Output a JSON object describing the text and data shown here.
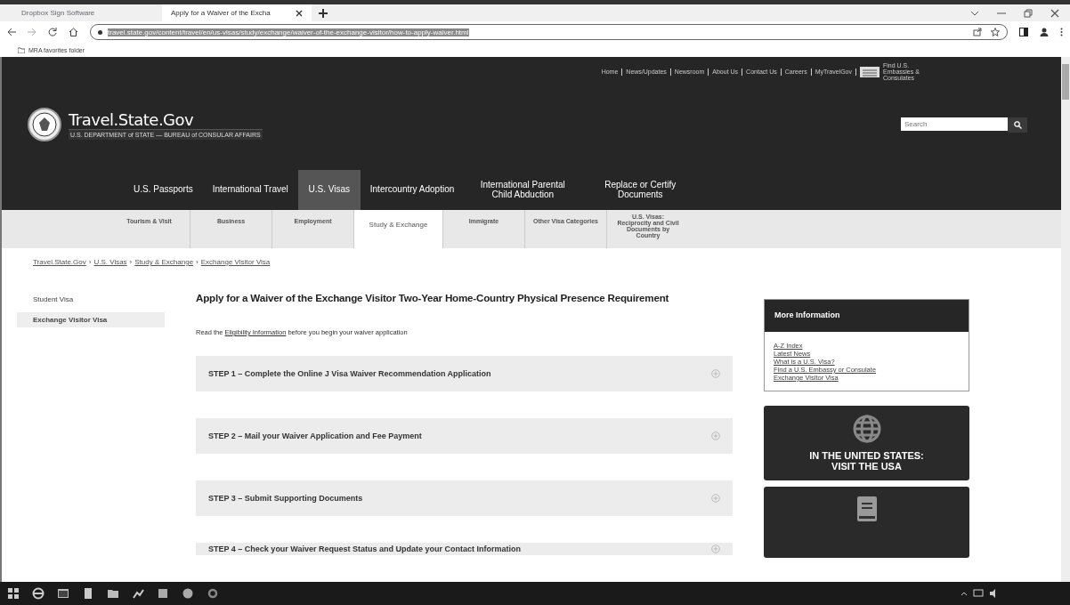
{
  "browser": {
    "tabs": [
      {
        "title": "Dropbox Sign Software",
        "selected": false
      },
      {
        "title": "Apply for a Waiver of the Excha",
        "selected": true
      }
    ],
    "url": "travel.state.gov/content/travel/en/us-visas/study/exchange/waiver-of-the-exchange-visitor/how-to-apply-waiver.html",
    "bookmarks": [
      "MRA favorites folder"
    ]
  },
  "utility_links": [
    "Home",
    "News/Updates",
    "Newsroom",
    "About Us",
    "Contact Us",
    "Careers",
    "MyTravelGov"
  ],
  "embassy_link": "Find U.S. Embassies & Consulates",
  "logo": {
    "title": "Travel.State.Gov",
    "subtitle": "U.S. DEPARTMENT of STATE — BUREAU of CONSULAR AFFAIRS"
  },
  "search": {
    "placeholder": "Search"
  },
  "main_nav": [
    {
      "label": "U.S. Passports",
      "selected": false
    },
    {
      "label": "International Travel",
      "selected": false
    },
    {
      "label": "U.S. Visas",
      "selected": true
    },
    {
      "label": "Intercountry Adoption",
      "selected": false
    },
    {
      "label": "International Parental Child Abduction",
      "selected": false
    },
    {
      "label": "Replace or Certify Documents",
      "selected": false
    }
  ],
  "sub_nav": [
    {
      "label": "Tourism & Visit",
      "selected": false
    },
    {
      "label": "Business",
      "selected": false
    },
    {
      "label": "Employment",
      "selected": false
    },
    {
      "label": "Study & Exchange",
      "selected": true
    },
    {
      "label": "Immigrate",
      "selected": false
    },
    {
      "label": "Other Visa Categories",
      "selected": false
    },
    {
      "label": "U.S. Visas: Reciprocity and Civil Documents by Country",
      "selected": false
    }
  ],
  "breadcrumb": [
    "Travel.State.Gov",
    "U.S. Visas",
    "Study & Exchange",
    "Exchange Visitor Visa"
  ],
  "breadcrumb_separator": "›",
  "sidebar": [
    {
      "label": "Student Visa",
      "selected": false
    },
    {
      "label": "Exchange Visitor Visa",
      "selected": true
    }
  ],
  "title": "Apply for a Waiver of the Exchange Visitor Two-Year Home-Country Physical Presence Requirement",
  "intro": {
    "before": "Read the",
    "link": "Eligibility Information",
    "after": "before you begin your waiver application"
  },
  "steps": [
    "STEP 1 – Complete the Online J Visa Waiver Recommendation Application",
    "STEP 2 – Mail your Waiver Application and Fee Payment",
    "STEP 3 – Submit Supporting Documents",
    "STEP 4 – Check your Waiver Request Status and Update your Contact Information"
  ],
  "more_info": {
    "title": "More Information",
    "links": [
      "A-Z Index",
      "Latest News",
      "What is a U.S. Visa?",
      "Find a U.S. Embassy or Consulate",
      "Exchange Visitor Visa"
    ]
  },
  "cards": [
    {
      "kind": "globe",
      "text": "IN THE UNITED STATES:\nVISIT THE USA"
    },
    {
      "kind": "book"
    }
  ]
}
